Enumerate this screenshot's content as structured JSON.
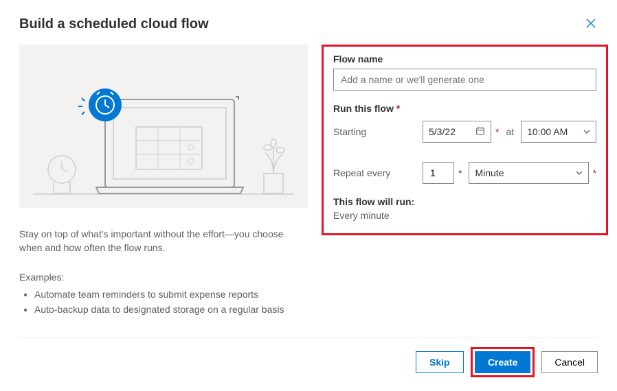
{
  "title": "Build a scheduled cloud flow",
  "description": "Stay on top of what's important without the effort—you choose when and how often the flow runs.",
  "examples_label": "Examples:",
  "examples": [
    "Automate team reminders to submit expense reports",
    "Auto-backup data to designated storage on a regular basis"
  ],
  "form": {
    "flow_name_label": "Flow name",
    "flow_name_placeholder": "Add a name or we'll generate one",
    "run_label": "Run this flow",
    "starting_label": "Starting",
    "starting_date": "5/3/22",
    "at_label": "at",
    "starting_time": "10:00 AM",
    "repeat_label": "Repeat every",
    "repeat_value": "1",
    "repeat_unit": "Minute",
    "summary_label": "This flow will run:",
    "summary_text": "Every minute"
  },
  "footer": {
    "skip": "Skip",
    "create": "Create",
    "cancel": "Cancel"
  }
}
